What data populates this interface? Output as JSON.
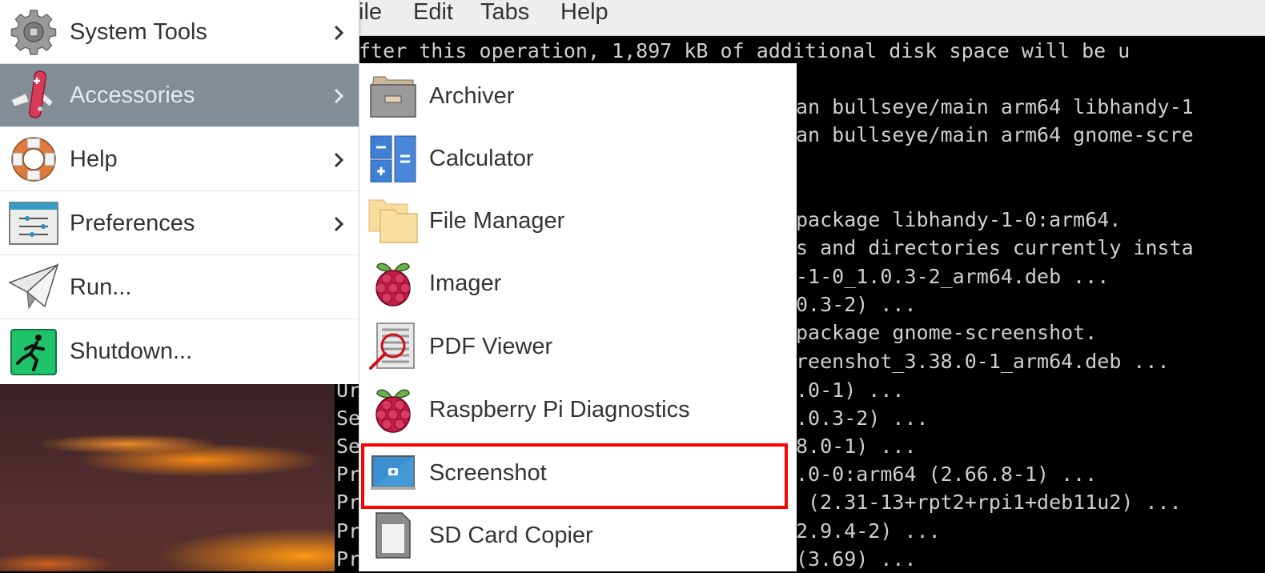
{
  "terminal": {
    "menubar": [
      "ile",
      "Edit",
      "Tabs",
      "Help"
    ],
    "lines": [
      "fter this operation, 1,897 kB of additional disk space will be u",
      "",
      "an bullseye/main arm64 libhandy-1",
      "an bullseye/main arm64 gnome-scre",
      "",
      "",
      "package libhandy-1-0:arm64.",
      "s and directories currently insta",
      "-1-0_1.0.3-2_arm64.deb ...",
      "0.3-2) ...",
      "package gnome-screenshot.",
      "reenshot_3.38.0-1_arm64.deb ...",
      ".0-1) ...",
      ".0.3-2) ...",
      "8.0-1) ...",
      ".0-0:arm64 (2.66.8-1) ...",
      " (2.31-13+rpt2+rpi1+deb11u2) ...",
      "2.9.4-2) ...",
      "(3.69) ..."
    ],
    "left_fragments": [
      "Ur",
      "Se",
      "Se",
      "Pr",
      "Pr",
      "Pr",
      "Pr"
    ]
  },
  "main_menu": {
    "items": [
      {
        "label": "System Tools",
        "icon": "gear-icon",
        "has_submenu": true,
        "active": false
      },
      {
        "label": "Accessories",
        "icon": "swiss-knife-icon",
        "has_submenu": true,
        "active": true
      },
      {
        "label": "Help",
        "icon": "lifebuoy-icon",
        "has_submenu": true,
        "active": false
      },
      {
        "label": "Preferences",
        "icon": "sliders-icon",
        "has_submenu": true,
        "active": false
      },
      {
        "label": "Run...",
        "icon": "paper-plane-icon",
        "has_submenu": false,
        "active": false
      },
      {
        "label": "Shutdown...",
        "icon": "exit-icon",
        "has_submenu": false,
        "active": false
      }
    ]
  },
  "sub_menu": {
    "items": [
      {
        "label": "Archiver",
        "icon": "archive-drawer-icon"
      },
      {
        "label": "Calculator",
        "icon": "calculator-icon"
      },
      {
        "label": "File Manager",
        "icon": "folder-icon"
      },
      {
        "label": "Imager",
        "icon": "raspberry-icon"
      },
      {
        "label": "PDF Viewer",
        "icon": "pdf-viewer-icon"
      },
      {
        "label": "Raspberry Pi Diagnostics",
        "icon": "raspberry-icon"
      },
      {
        "label": "Screenshot",
        "icon": "screenshot-icon",
        "highlighted": true
      },
      {
        "label": "SD Card Copier",
        "icon": "sd-card-icon"
      }
    ]
  },
  "colors": {
    "active_item_bg": "#838d95",
    "highlight_border": "#ff0000",
    "terminal_bg": "#000000",
    "terminal_fg": "#cfcfcf"
  }
}
